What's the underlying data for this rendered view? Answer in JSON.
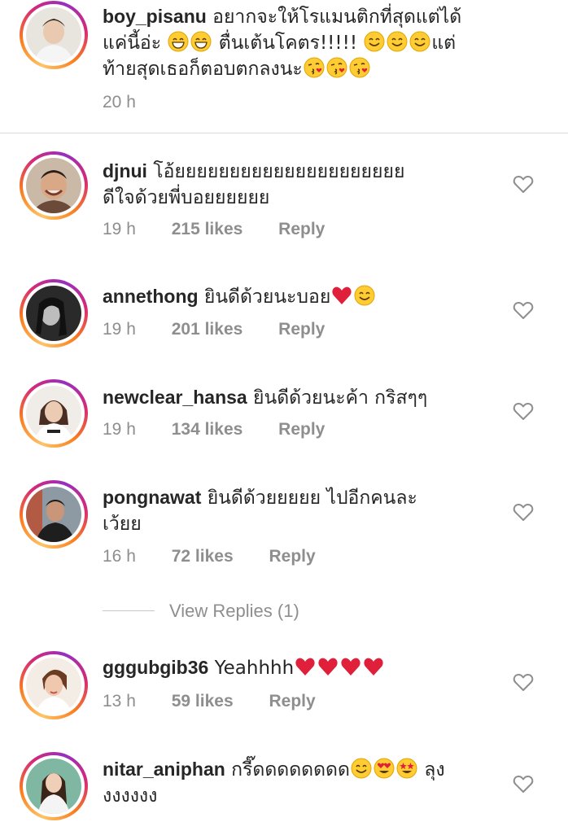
{
  "caption": {
    "username": "boy_pisanu",
    "text_1": "อยากจะให้โรแมนติกที่สุดแต่ได้",
    "text_2": "แค่นี้อ่ะ",
    "text_3": "ตื่นเต้นโคตร!!!!!",
    "text_4": "แต่",
    "text_5": "ท้ายสุดเธอก็ตอบตกลงนะ",
    "time": "20 h"
  },
  "comments": [
    {
      "username": "djnui",
      "text_1": "โอ้ยยยยยยยยยยยยยยยยยยยยย",
      "text_2": "ดีใจด้วยพี่บอยยยยยย",
      "time": "19 h",
      "likes": "215 likes",
      "reply": "Reply"
    },
    {
      "username": "annethong",
      "text_1": "ยินดีด้วยนะบอย",
      "time": "19 h",
      "likes": "201 likes",
      "reply": "Reply"
    },
    {
      "username": "newclear_hansa",
      "text_1": "ยินดีด้วยนะค้า กริสๆๆ",
      "time": "19 h",
      "likes": "134 likes",
      "reply": "Reply"
    },
    {
      "username": "pongnawat",
      "text_1": "ยินดีด้วยยยยย ไปอีกคนละ",
      "text_2": "เว้ยย",
      "time": "16 h",
      "likes": "72 likes",
      "reply": "Reply"
    },
    {
      "username": "gggubgib36",
      "text_1": "Yeahhhh",
      "time": "13 h",
      "likes": "59 likes",
      "reply": "Reply"
    },
    {
      "username": "nitar_aniphan",
      "text_1": "กรี๊ดดดดดดดด",
      "text_2": "ลุง",
      "text_3": "งงงงงง",
      "time": "",
      "likes": "",
      "reply": ""
    }
  ],
  "view_replies": "View Replies (1)",
  "icons": {
    "heart": "heart-outline-icon",
    "emoji_smile": "smiling-face-emoji",
    "emoji_grin": "grinning-face-emoji",
    "emoji_kiss": "face-blowing-kiss-emoji",
    "emoji_heart": "red-heart-emoji",
    "emoji_heart_eyes": "heart-eyes-emoji",
    "emoji_star_struck": "star-struck-emoji"
  },
  "colors": {
    "text": "#262626",
    "muted": "#8e8e8e",
    "divider": "#dbdbdb",
    "heart_red": "#e0203a",
    "emoji_yellow": "#ffcc33"
  }
}
